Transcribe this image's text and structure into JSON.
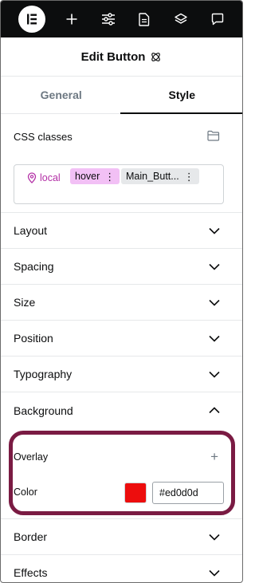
{
  "topbar": {
    "logo_icon": "elementor-logo-icon",
    "icons": [
      "plus-icon",
      "sliders-icon",
      "page-icon",
      "layers-icon",
      "chat-icon"
    ]
  },
  "header": {
    "title": "Edit Button",
    "icon": "element-icon"
  },
  "tabs": [
    {
      "label": "General",
      "active": false
    },
    {
      "label": "Style",
      "active": true
    }
  ],
  "css_classes": {
    "label": "CSS classes",
    "chips": [
      {
        "label": "local",
        "icon": "map-pin-icon",
        "color": "#b32fa6"
      },
      {
        "label": "hover",
        "menu": "⋮",
        "background": "#f2c0f5"
      },
      {
        "label": "Main_Butt...",
        "menu": "⋮",
        "background": "#e6e8ea"
      }
    ]
  },
  "sections": {
    "layout": "Layout",
    "spacing": "Spacing",
    "size": "Size",
    "position": "Position",
    "typography": "Typography",
    "background": "Background",
    "border": "Border",
    "effects": "Effects"
  },
  "background": {
    "overlay_label": "Overlay",
    "overlay_add": "+",
    "color_label": "Color",
    "color_value": "#ed0d0d",
    "highlight_color": "#7a1b43"
  }
}
